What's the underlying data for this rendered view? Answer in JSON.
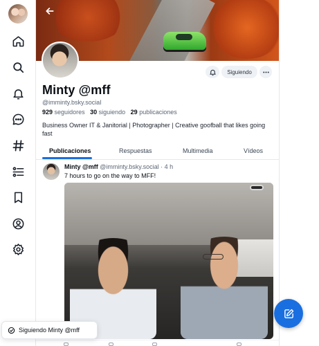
{
  "nav": {
    "items": [
      {
        "name": "home-icon"
      },
      {
        "name": "search-icon"
      },
      {
        "name": "bell-icon"
      },
      {
        "name": "chat-icon"
      },
      {
        "name": "hashtag-icon"
      },
      {
        "name": "list-icon"
      },
      {
        "name": "bookmark-icon"
      },
      {
        "name": "profile-icon"
      },
      {
        "name": "settings-icon"
      }
    ]
  },
  "profile": {
    "display_name": "Minty @mff",
    "handle": "@imminty.bsky.social",
    "followers_count": "929",
    "followers_label": "seguidores",
    "following_count": "30",
    "following_label": "siguiendo",
    "posts_count": "29",
    "posts_label": "publicaciones",
    "bio": "Business Owner IT & Janitorial | Photographer | Creative goofball that likes going fast",
    "follow_button": "Siguiendo"
  },
  "tabs": [
    {
      "label": "Publicaciones",
      "active": true
    },
    {
      "label": "Respuestas",
      "active": false
    },
    {
      "label": "Multimedia",
      "active": false
    },
    {
      "label": "Vídeos",
      "active": false
    }
  ],
  "post": {
    "author_name": "Minty @mff",
    "author_handle": "@imminty.bsky.social",
    "time_separator": "·",
    "time": "4 h",
    "text": "7 hours to go on the way to MFF!"
  },
  "toast": {
    "text": "Siguiendo Minty @mff"
  },
  "colors": {
    "accent": "#1a6fe0",
    "text_primary": "#0b0f14",
    "text_secondary": "#5b6675",
    "pill_background": "#eef1f5"
  }
}
